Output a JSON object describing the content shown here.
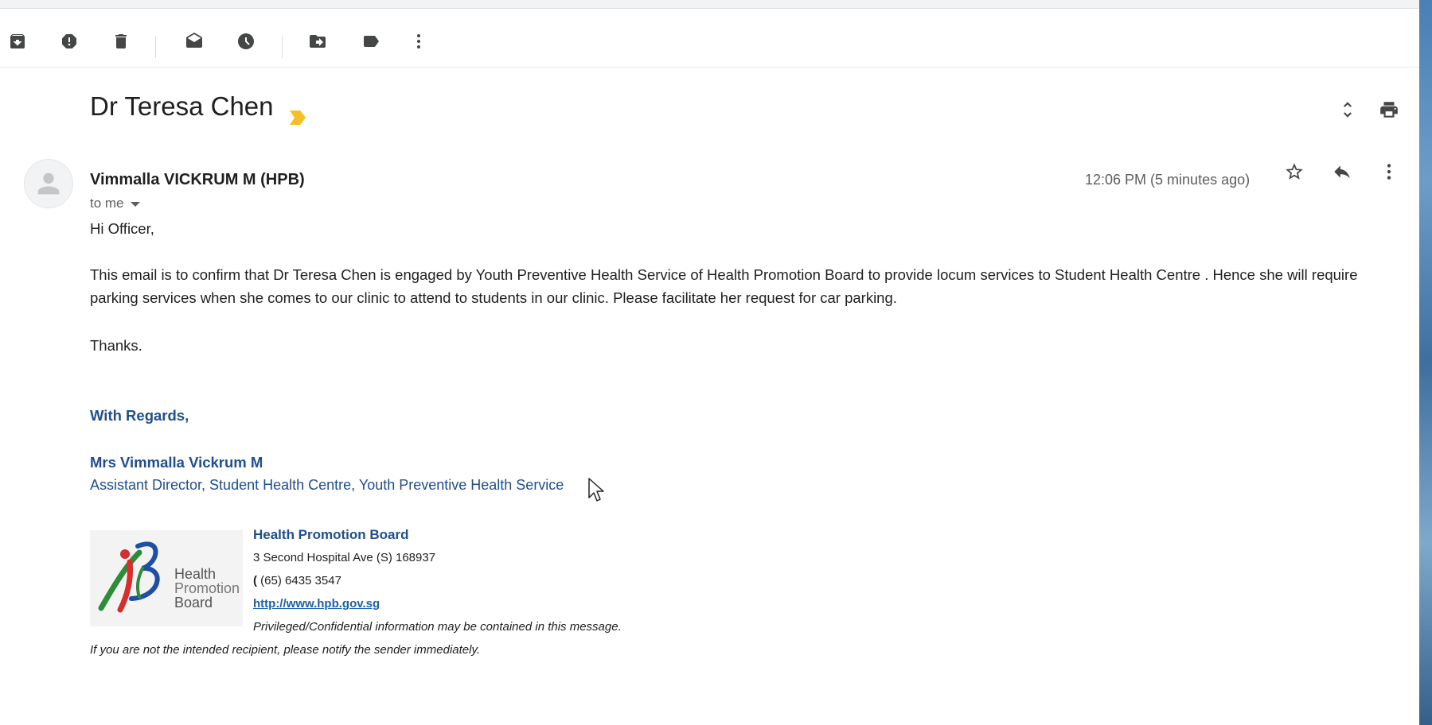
{
  "browser": {
    "clipped_tab_text": "..."
  },
  "toolbar": {
    "icons": [
      "archive-icon",
      "report-spam-icon",
      "delete-icon",
      "mark-as-read-icon",
      "snooze-icon",
      "move-to-icon",
      "label-icon",
      "more-vert-icon"
    ]
  },
  "email": {
    "subject": "Dr Teresa Chen",
    "label_color": "#f6bf26",
    "sender": "Vimmalla VICKRUM M (HPB)",
    "to": "to me",
    "time": "12:06 PM (5 minutes ago)",
    "greeting": "Hi Officer,",
    "paragraph": "This email is to confirm that Dr Teresa Chen is engaged by Youth Preventive Health Service of Health Promotion Board  to provide locum services to Student Health Centre .  Hence she will require parking services when she comes to our clinic to attend to students in our clinic. Please facilitate her request for car parking.",
    "thanks": "Thanks.",
    "signature": {
      "regards": "With Regards,",
      "name": "Mrs Vimmalla Vickrum M",
      "title": "Assistant Director, Student Health Centre, Youth Preventive Health Service",
      "org": "Health Promotion Board",
      "address": "3 Second Hospital Ave (S) 168937",
      "phone_prefix": "(",
      "phone": " (65) 6435 3547",
      "url": "http://www.hpb.gov.sg",
      "disclaimer1": "Privileged/Confidential information may be contained in this message.",
      "disclaimer2": "If you are not the intended recipient, please notify the sender immediately.",
      "logo_text": [
        "Health",
        "Promotion",
        "Board"
      ]
    }
  },
  "colors": {
    "signature_blue": "#1f4e96",
    "link_blue": "#1a5fb4"
  }
}
